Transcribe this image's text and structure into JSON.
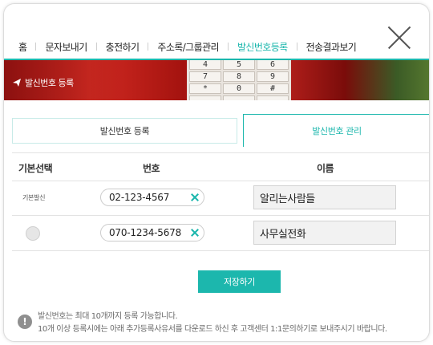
{
  "nav": {
    "items": [
      {
        "label": "홈"
      },
      {
        "label": "문자보내기"
      },
      {
        "label": "충전하기"
      },
      {
        "label": "주소록/그룹관리"
      },
      {
        "label": "발신번호등록",
        "active": true
      },
      {
        "label": "전송결과보기"
      }
    ]
  },
  "banner": {
    "title": "발신번호 등록",
    "keys": [
      "4",
      "5",
      "6",
      "7",
      "8",
      "9",
      "*",
      "0",
      "#",
      "",
      "",
      ""
    ]
  },
  "tabs": {
    "register": "발신번호 등록",
    "manage": "발신번호 관리"
  },
  "table": {
    "headers": {
      "default": "기본선택",
      "number": "번호",
      "name": "이름"
    },
    "rows": [
      {
        "default_label": "기본발신",
        "number": "02-123-4567",
        "name": "알리는사람들"
      },
      {
        "default_label": "",
        "number": "070-1234-5678",
        "name": "사무실전화"
      }
    ]
  },
  "save_label": "저장하기",
  "notice": {
    "line1": "발신번호는 최대 10개까지 등록 가능합니다.",
    "line2": "10개 이상 등록시에는 아래 추가등록사유서를 다운로드 하신 후 고객센터 1:1문의하기로 보내주시기 바랍니다."
  },
  "colors": {
    "accent": "#1cb7ad"
  }
}
